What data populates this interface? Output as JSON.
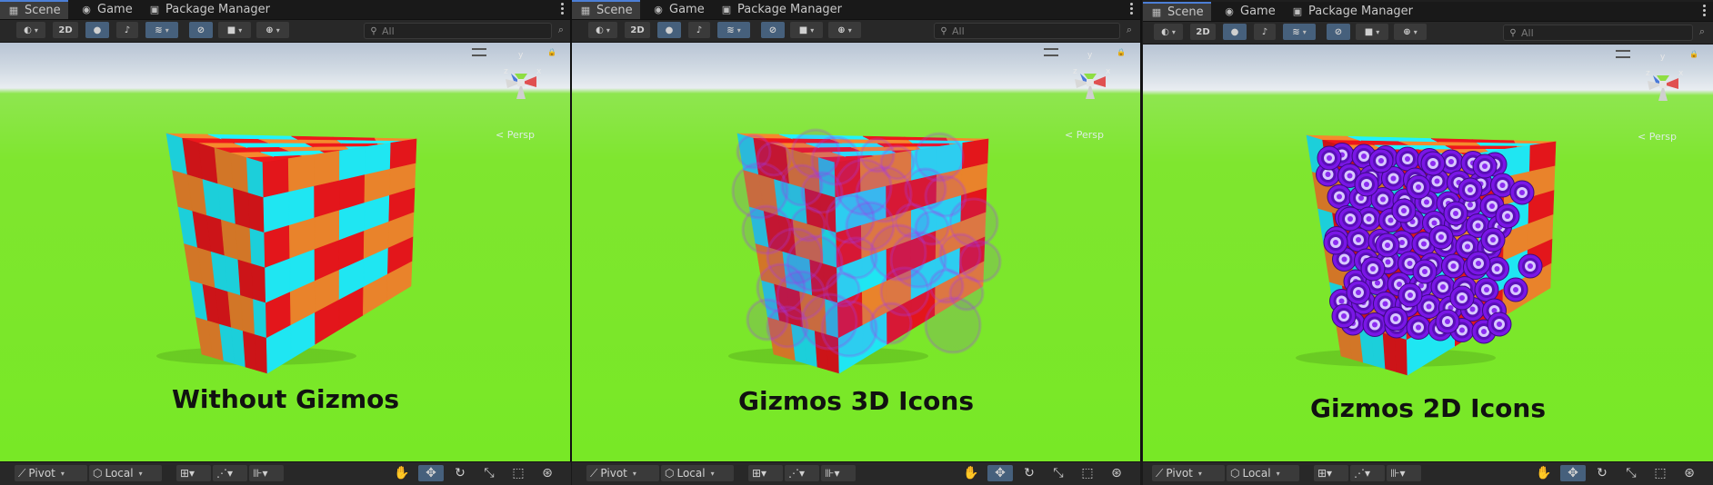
{
  "tabs": {
    "scene": "Scene",
    "game": "Game",
    "package_manager": "Package Manager"
  },
  "toolbar": {
    "mode_2d": "2D",
    "search_placeholder": "All"
  },
  "bottom_toolbar": {
    "pivot": "Pivot",
    "local": "Local"
  },
  "gizmo_axes": {
    "y": "y",
    "x": "x",
    "z": "z"
  },
  "perspective_label": "< Persp",
  "panels": [
    {
      "caption": "Without Gizmos"
    },
    {
      "caption": "Gizmos 3D Icons"
    },
    {
      "caption": "Gizmos 2D Icons"
    }
  ],
  "colors": {
    "cube_red": "#e3161b",
    "cube_cyan": "#1fe6f2",
    "cube_orange": "#e9832b",
    "icon_purple": "#7a16e6",
    "ground": "#7be82a",
    "selection_blue": "#4c7fd6"
  }
}
